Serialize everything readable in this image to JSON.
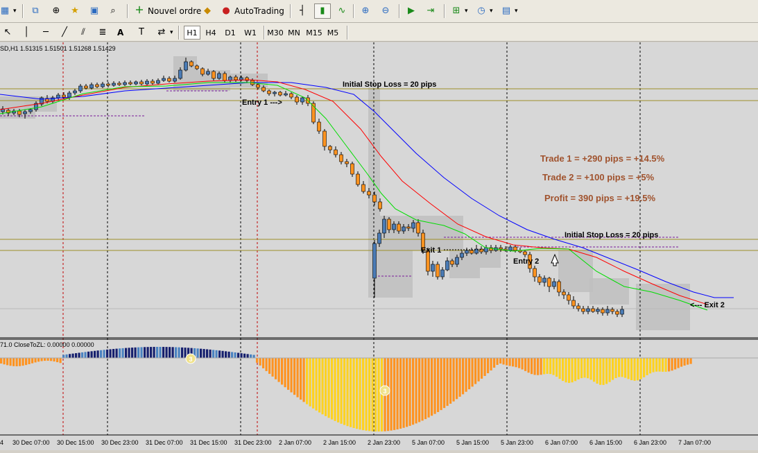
{
  "toolbar1": {
    "new_order_label": "Nouvel ordre",
    "autotrading_label": "AutoTrading"
  },
  "toolbar2": {
    "timeframes": [
      "H1",
      "H4",
      "D1",
      "W1",
      "M30",
      "MN",
      "M15",
      "M5"
    ],
    "active_timeframe": "H1",
    "text_tool": "A"
  },
  "chart": {
    "header": "SD,H1  1.51315 1.51501 1.51268 1.51429",
    "indicator_header": "71.0 CloseToZL: 0.00000 0.00000",
    "annotations": {
      "stop1": "Initial Stop Loss = 20 pips",
      "stop2": "Initial Stop Loss = 20 pips",
      "entry1": "Entry 1 --->",
      "entry2": "Entry 2",
      "exit1": "Exit 1",
      "exit2": "<--- Exit 2",
      "trade1": "Trade 1 = +290 pips = +14.5%",
      "trade2": "Trade 2 = +100 pips = +5%",
      "profit": "Profit = 390 pips = +19.5%"
    },
    "markers": [
      "3",
      "3"
    ],
    "time_labels": [
      "4",
      "30 Dec 07:00",
      "30 Dec 15:00",
      "30 Dec 23:00",
      "31 Dec 07:00",
      "31 Dec 15:00",
      "31 Dec 23:00",
      "2 Jan 07:00",
      "2 Jan 15:00",
      "2 Jan 23:00",
      "5 Jan 07:00",
      "5 Jan 15:00",
      "5 Jan 23:00",
      "6 Jan 07:00",
      "6 Jan 15:00",
      "6 Jan 23:00",
      "7 Jan 07:00"
    ],
    "colors": {
      "background": "#d7d7d7",
      "bull_candle": "#4a7bb5",
      "bear_candle": "#ff9320",
      "ma_blue": "#0000ff",
      "ma_red": "#ff0000",
      "ma_green": "#00dd00",
      "level_line": "#9c8f2a",
      "annotation_brown": "#a0522d",
      "hist_dark_blue": "#16206e",
      "hist_light_blue": "#4a82c0",
      "hist_orange": "#ff9320",
      "hist_yellow": "#ffd21f"
    }
  }
}
